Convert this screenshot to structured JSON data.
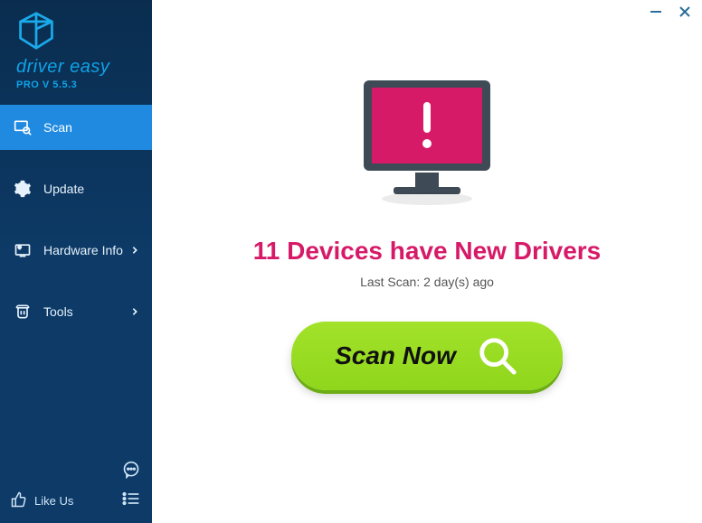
{
  "brand": {
    "name": "driver easy",
    "sub": "PRO V 5.5.3"
  },
  "nav": {
    "scan": "Scan",
    "update": "Update",
    "hardware": "Hardware Info",
    "tools": "Tools"
  },
  "footer": {
    "likeus": "Like Us"
  },
  "status": {
    "headline": "11 Devices have New Drivers",
    "last_scan": "Last Scan: 2 day(s) ago"
  },
  "actions": {
    "scan_now": "Scan Now"
  }
}
